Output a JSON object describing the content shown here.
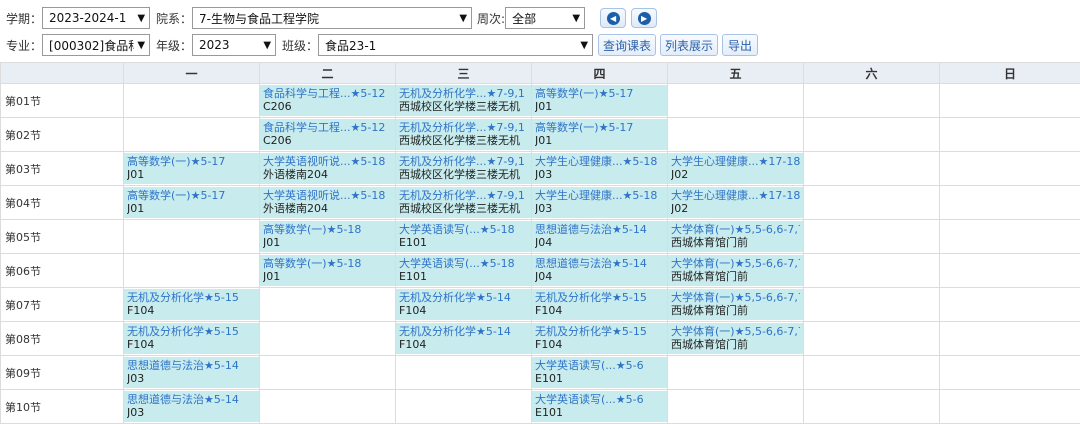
{
  "filters": {
    "term_label": "学期：",
    "term_value": "2023-2024-1",
    "dept_label": "院系：",
    "dept_value": "7-生物与食品工程学院",
    "week_label": "周次:",
    "week_value": "全部",
    "major_label": "专业：",
    "major_value": "[000302]食品科",
    "grade_label": "年级：",
    "grade_value": "2023",
    "class_label": "班级：",
    "class_value": "食品23-1",
    "query_button": "查询课表",
    "list_button": "列表展示",
    "export_button": "导出"
  },
  "table": {
    "days": [
      "一",
      "二",
      "三",
      "四",
      "五",
      "六",
      "日"
    ],
    "rows": [
      {
        "period": "第01节",
        "cells": [
          null,
          {
            "name": "食品科学与工程...★5-12",
            "room": "C206"
          },
          {
            "name": "无机及分析化学...★7-9,1",
            "room": "西城校区化学楼三楼无机"
          },
          {
            "name": "高等数学(一)★5-17",
            "room": "J01"
          },
          null,
          null,
          null
        ]
      },
      {
        "period": "第02节",
        "cells": [
          null,
          {
            "name": "食品科学与工程...★5-12",
            "room": "C206"
          },
          {
            "name": "无机及分析化学...★7-9,1",
            "room": "西城校区化学楼三楼无机"
          },
          {
            "name": "高等数学(一)★5-17",
            "room": "J01"
          },
          null,
          null,
          null
        ]
      },
      {
        "period": "第03节",
        "cells": [
          {
            "name": "高等数学(一)★5-17",
            "room": "J01"
          },
          {
            "name": "大学英语视听说...★5-18",
            "room": "外语楼南204"
          },
          {
            "name": "无机及分析化学...★7-9,1",
            "room": "西城校区化学楼三楼无机"
          },
          {
            "name": "大学生心理健康...★5-18",
            "room": "J03"
          },
          {
            "name": "大学生心理健康...★17-18",
            "room": "J02"
          },
          null,
          null
        ]
      },
      {
        "period": "第04节",
        "cells": [
          {
            "name": "高等数学(一)★5-17",
            "room": "J01"
          },
          {
            "name": "大学英语视听说...★5-18",
            "room": "外语楼南204"
          },
          {
            "name": "无机及分析化学...★7-9,1",
            "room": "西城校区化学楼三楼无机"
          },
          {
            "name": "大学生心理健康...★5-18",
            "room": "J03"
          },
          {
            "name": "大学生心理健康...★17-18",
            "room": "J02"
          },
          null,
          null
        ]
      },
      {
        "period": "第05节",
        "cells": [
          null,
          {
            "name": "高等数学(一)★5-18",
            "room": "J01"
          },
          {
            "name": "大学英语读写(...★5-18",
            "room": "E101"
          },
          {
            "name": "思想道德与法治★5-14",
            "room": "J04"
          },
          {
            "name": "大学体育(一)★5,5-6,6-7,7",
            "room": "西城体育馆门前"
          },
          null,
          null
        ]
      },
      {
        "period": "第06节",
        "cells": [
          null,
          {
            "name": "高等数学(一)★5-18",
            "room": "J01"
          },
          {
            "name": "大学英语读写(...★5-18",
            "room": "E101"
          },
          {
            "name": "思想道德与法治★5-14",
            "room": "J04"
          },
          {
            "name": "大学体育(一)★5,5-6,6-7,7",
            "room": "西城体育馆门前"
          },
          null,
          null
        ]
      },
      {
        "period": "第07节",
        "cells": [
          {
            "name": "无机及分析化学★5-15",
            "room": "F104"
          },
          null,
          {
            "name": "无机及分析化学★5-14",
            "room": "F104"
          },
          {
            "name": "无机及分析化学★5-15",
            "room": "F104"
          },
          {
            "name": "大学体育(一)★5,5-6,6-7,7",
            "room": "西城体育馆门前"
          },
          null,
          null
        ]
      },
      {
        "period": "第08节",
        "cells": [
          {
            "name": "无机及分析化学★5-15",
            "room": "F104"
          },
          null,
          {
            "name": "无机及分析化学★5-14",
            "room": "F104"
          },
          {
            "name": "无机及分析化学★5-15",
            "room": "F104"
          },
          {
            "name": "大学体育(一)★5,5-6,6-7,7",
            "room": "西城体育馆门前"
          },
          null,
          null
        ]
      },
      {
        "period": "第09节",
        "cells": [
          {
            "name": "思想道德与法治★5-14",
            "room": "J03"
          },
          null,
          null,
          {
            "name": "大学英语读写(...★5-6",
            "room": "E101"
          },
          null,
          null,
          null
        ]
      },
      {
        "period": "第10节",
        "cells": [
          {
            "name": "思想道德与法治★5-14",
            "room": "J03"
          },
          null,
          null,
          {
            "name": "大学英语读写(...★5-6",
            "room": "E101"
          },
          null,
          null,
          null
        ]
      }
    ]
  }
}
